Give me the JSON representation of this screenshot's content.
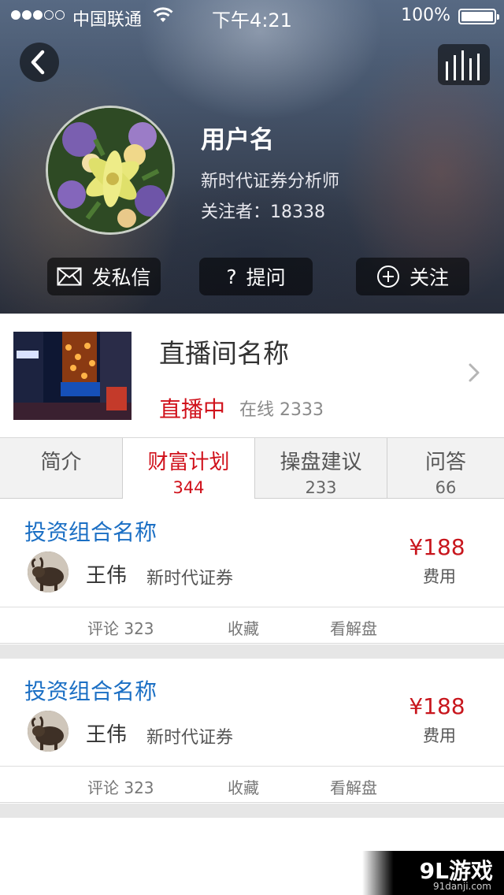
{
  "status_bar": {
    "carrier": "中国联通",
    "time": "下午4:21",
    "battery": "100%"
  },
  "header": {
    "back_icon": "chevron-left-icon",
    "chart_icon": "bar-chart-icon",
    "user_name": "用户名",
    "user_title": "新时代证券分析师",
    "followers": "关注者：18338",
    "buttons": {
      "message": "发私信",
      "ask": "提问",
      "follow": "关注"
    }
  },
  "live_room": {
    "name": "直播间名称",
    "status": "直播中",
    "online": "在线 2333",
    "status_color": "#d0111b"
  },
  "tabs": [
    {
      "label": "简介",
      "count": ""
    },
    {
      "label": "财富计划",
      "count": "344"
    },
    {
      "label": "操盘建议",
      "count": "233"
    },
    {
      "label": "问答",
      "count": "66"
    }
  ],
  "active_tab": "财富计划",
  "portfolios": [
    {
      "name": "投资组合名称",
      "person": "王伟",
      "org": "新时代证券",
      "price": "¥188",
      "fee_label": "费用",
      "actions": {
        "comments": "评论 323",
        "favorite": "收藏",
        "view": "看解盘"
      }
    },
    {
      "name": "投资组合名称",
      "person": "王伟",
      "org": "新时代证券",
      "price": "¥188",
      "fee_label": "费用",
      "actions": {
        "comments": "评论 323",
        "favorite": "收藏",
        "view": "看解盘"
      }
    }
  ],
  "watermark": {
    "logo": "9L游戏",
    "url": "91danji.com"
  },
  "colors": {
    "accent_red": "#d0111b",
    "link_blue": "#1b6fc4",
    "price_red": "#c8161d"
  }
}
